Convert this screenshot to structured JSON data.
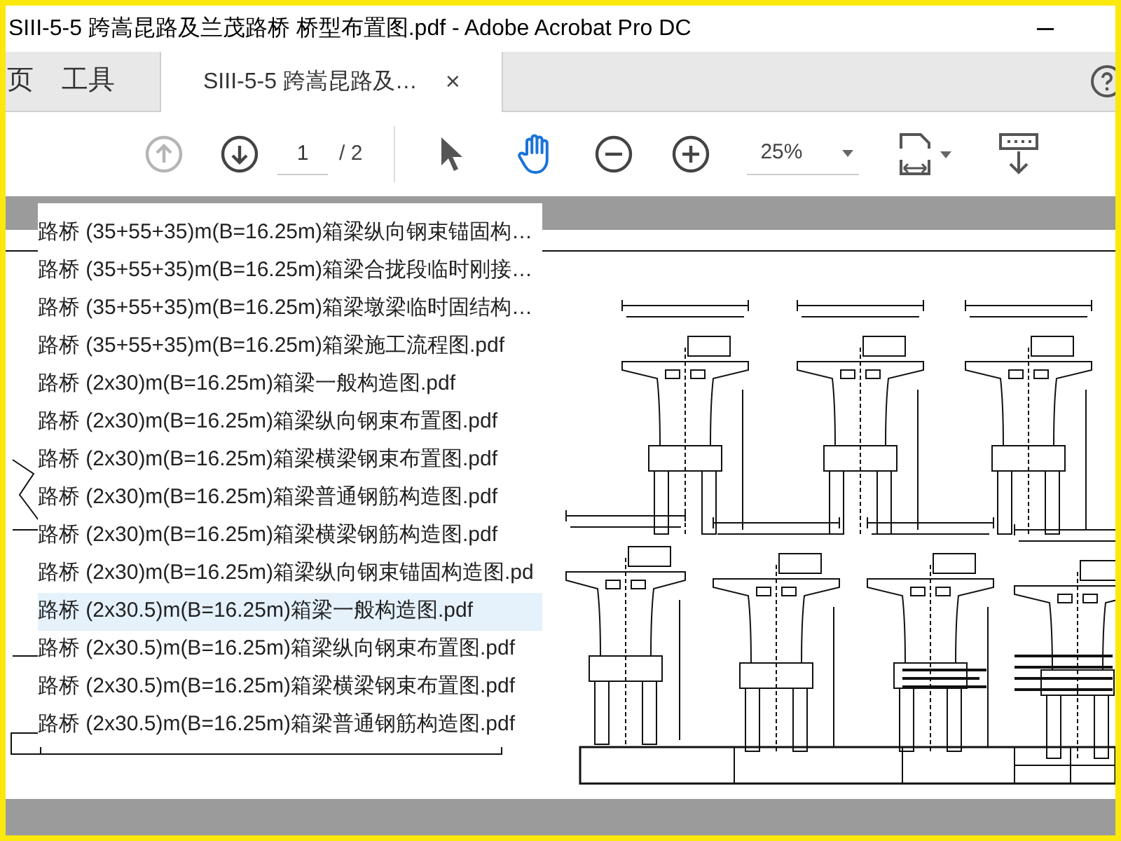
{
  "window": {
    "title": "SIII-5-5 跨嵩昆路及兰茂路桥 桥型布置图.pdf - Adobe Acrobat Pro DC"
  },
  "tabs": [
    {
      "label": "页",
      "selected": false
    },
    {
      "label": "工具",
      "selected": false
    },
    {
      "label": "SIII-5-5 跨嵩昆路及…",
      "selected": true,
      "close": "×"
    }
  ],
  "toolbar": {
    "prev_page": {
      "disabled": true
    },
    "next_page": {
      "disabled": false
    },
    "page_number": "1",
    "page_total": "/ 2",
    "tools": [
      {
        "kind": "select",
        "selected": false
      },
      {
        "kind": "hand",
        "selected": true
      }
    ],
    "zoom": "25%"
  },
  "file_list": [
    {
      "name": "路桥 (35+55+35)m(B=16.25m)箱梁纵向钢束锚固构…",
      "selected": false
    },
    {
      "name": "路桥 (35+55+35)m(B=16.25m)箱梁合拢段临时刚接…",
      "selected": false
    },
    {
      "name": "路桥 (35+55+35)m(B=16.25m)箱梁墩梁临时固结构…",
      "selected": false
    },
    {
      "name": "路桥 (35+55+35)m(B=16.25m)箱梁施工流程图.pdf",
      "selected": false
    },
    {
      "name": "路桥 (2x30)m(B=16.25m)箱梁一般构造图.pdf",
      "selected": false
    },
    {
      "name": "路桥 (2x30)m(B=16.25m)箱梁纵向钢束布置图.pdf",
      "selected": false
    },
    {
      "name": "路桥 (2x30)m(B=16.25m)箱梁横梁钢束布置图.pdf",
      "selected": false
    },
    {
      "name": "路桥 (2x30)m(B=16.25m)箱梁普通钢筋构造图.pdf",
      "selected": false
    },
    {
      "name": "路桥 (2x30)m(B=16.25m)箱梁横梁钢筋构造图.pdf",
      "selected": false
    },
    {
      "name": "路桥 (2x30)m(B=16.25m)箱梁纵向钢束锚固构造图.pd",
      "selected": false
    },
    {
      "name": "路桥 (2x30.5)m(B=16.25m)箱梁一般构造图.pdf",
      "selected": true
    },
    {
      "name": "路桥 (2x30.5)m(B=16.25m)箱梁纵向钢束布置图.pdf",
      "selected": false
    },
    {
      "name": "路桥 (2x30.5)m(B=16.25m)箱梁横梁钢束布置图.pdf",
      "selected": false
    },
    {
      "name": "路桥 (2x30.5)m(B=16.25m)箱梁普通钢筋构造图.pdf",
      "selected": false
    }
  ]
}
